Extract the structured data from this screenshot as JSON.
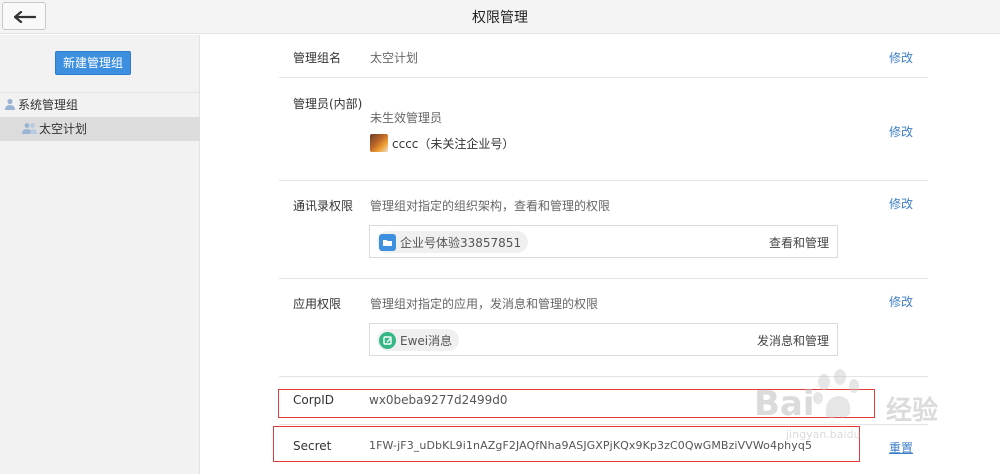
{
  "header": {
    "title": "权限管理",
    "back_icon": "arrow-left-icon"
  },
  "sidebar": {
    "new_group_label": "新建管理组",
    "tree": [
      {
        "label": "系统管理组",
        "icon": "user-icon"
      },
      {
        "label": "太空计划",
        "icon": "users-icon",
        "selected": true
      }
    ]
  },
  "rows": {
    "group_name": {
      "label": "管理组名",
      "value": "太空计划",
      "edit": "修改"
    },
    "admins": {
      "label": "管理员(内部)",
      "subtitle": "未生效管理员",
      "member": "cccc（未关注企业号）",
      "edit": "修改"
    },
    "contacts": {
      "label": "通讯录权限",
      "description": "管理组对指定的组织架构，查看和管理的权限",
      "item": "企业号体验33857851",
      "permission": "查看和管理",
      "edit": "修改"
    },
    "apps": {
      "label": "应用权限",
      "description": "管理组对指定的应用，发消息和管理的权限",
      "item": "Ewei消息",
      "permission": "发消息和管理",
      "edit": "修改"
    },
    "corpid": {
      "label": "CorpID",
      "value": "wx0beba9277d2499d0"
    },
    "secret": {
      "label": "Secret",
      "value": "1FW-jF3_uDbKL9i1nAZgF2JAQfNha9ASJGXPjKQx9Kp3zC0QwGMBziVVWo4phyq5",
      "action": "重置"
    }
  },
  "watermark": {
    "brand": "Bai",
    "brand_end": "经验",
    "url_fragment": "jingyan.baidu"
  },
  "colors": {
    "accent": "#3d8fe0",
    "link": "#3d7fc7",
    "highlight_border": "#e23a3a"
  }
}
